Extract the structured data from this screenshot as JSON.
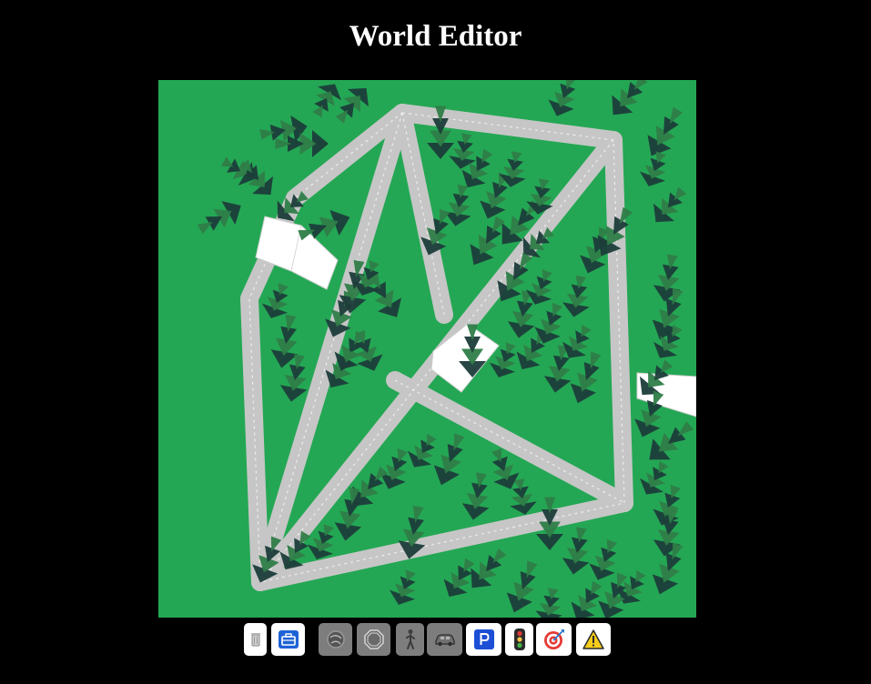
{
  "header": {
    "title": "World Editor"
  },
  "canvas": {
    "grass_color": "#24a754",
    "road_color": "#c6c6c6",
    "road_marking_color": "#ededed",
    "tree_dark_color": "#1c3d3a",
    "tree_light_color": "#2f7d48",
    "building_color": "#ffffff"
  },
  "toolbar": {
    "tools": [
      {
        "icon": "trash-icon",
        "active": true
      },
      {
        "icon": "briefcase-icon",
        "active": true
      },
      {
        "icon": "graph-icon",
        "active": false
      },
      {
        "icon": "stop-icon",
        "active": false
      },
      {
        "icon": "crossing-icon",
        "active": false
      },
      {
        "icon": "car-icon",
        "active": false
      },
      {
        "icon": "parking-icon",
        "active": true
      },
      {
        "icon": "traffic-light-icon",
        "active": true
      },
      {
        "icon": "target-icon",
        "active": true
      },
      {
        "icon": "yield-icon",
        "active": true
      }
    ]
  }
}
